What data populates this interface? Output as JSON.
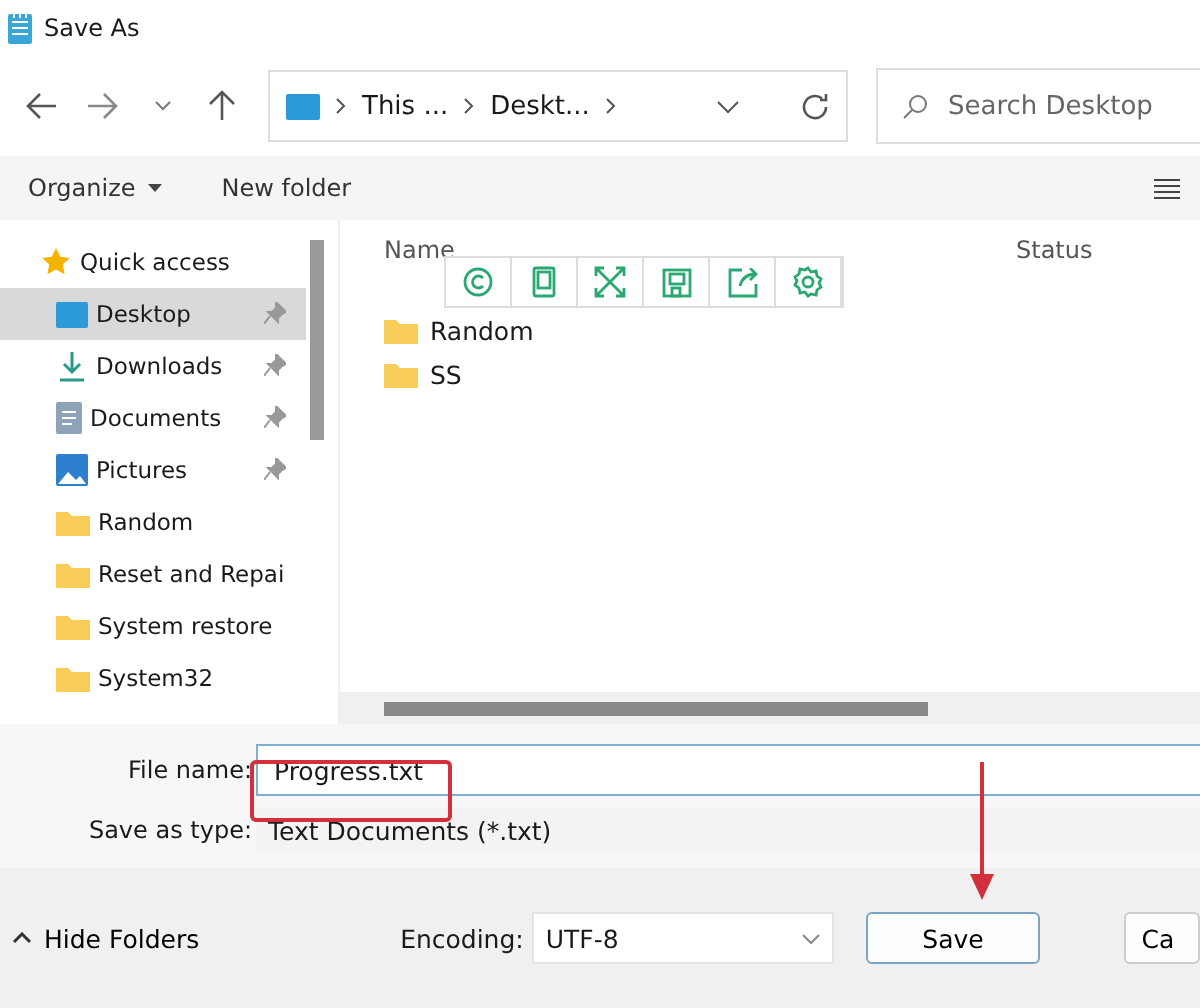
{
  "window": {
    "title": "Save As"
  },
  "breadcrumb": [
    "This ...",
    "Deskt..."
  ],
  "search": {
    "placeholder": "Search Desktop"
  },
  "commands": {
    "organize": "Organize",
    "new_folder": "New folder"
  },
  "sidebar": {
    "items": [
      {
        "label": "Quick access",
        "kind": "star",
        "pinned": false,
        "selected": false
      },
      {
        "label": "Desktop",
        "kind": "desktop",
        "pinned": true,
        "selected": true
      },
      {
        "label": "Downloads",
        "kind": "download",
        "pinned": true,
        "selected": false
      },
      {
        "label": "Documents",
        "kind": "document",
        "pinned": true,
        "selected": false
      },
      {
        "label": "Pictures",
        "kind": "picture",
        "pinned": true,
        "selected": false
      },
      {
        "label": "Random",
        "kind": "folder",
        "pinned": false,
        "selected": false
      },
      {
        "label": "Reset and Repai",
        "kind": "folder",
        "pinned": false,
        "selected": false
      },
      {
        "label": "System restore",
        "kind": "folder",
        "pinned": false,
        "selected": false
      },
      {
        "label": "System32",
        "kind": "folder",
        "pinned": false,
        "selected": false
      }
    ]
  },
  "table": {
    "columns": [
      "Name",
      "Status"
    ],
    "rows": [
      {
        "name": "Random"
      },
      {
        "name": "SS"
      }
    ]
  },
  "form": {
    "file_name_label": "File name:",
    "file_name": "Progress.txt",
    "type_label": "Save as type:",
    "type": "Text Documents (*.txt)"
  },
  "footer": {
    "hide_folders": "Hide Folders",
    "encoding_label": "Encoding:",
    "encoding": "UTF-8",
    "buttons": [
      "Save",
      "Ca"
    ]
  }
}
